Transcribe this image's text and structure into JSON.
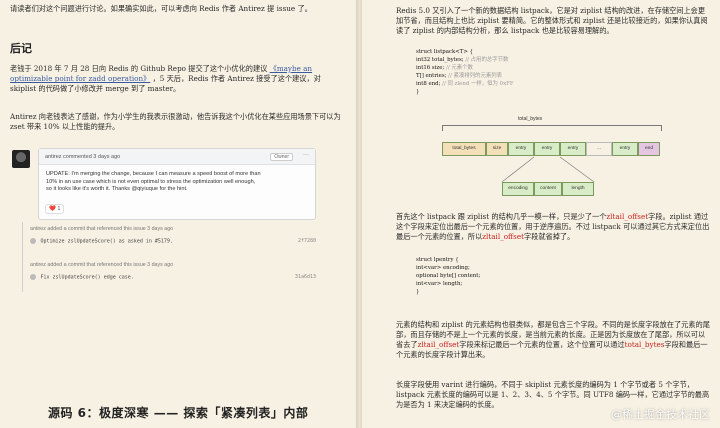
{
  "left": {
    "intro": "请读者们对这个问题进行讨论。如果确实如此，可以考虑向 Redis 作者 Antirez 提 issue 了。",
    "section_title": "后记",
    "para1_a": "老钱于 2018 年 7 月 28 日向 Redis 的 Github Repo 提交了这个小优化的建议",
    "para1_link": "《maybe an optimizable point for zadd operation》",
    "para1_b": "，5 天后，Redis 作者 Antirez 接受了这个建议，对 skiplist 的代码做了小修改并 merge 到了 master。",
    "para2": "Antirez 向老钱表达了感谢，作为小学生的我表示很激动，他告诉我这个小优化在某些应用场景下可以为 zset 带来 10% 以上性能的提升。",
    "comment": {
      "author_line": "antirez commented 3 days ago",
      "owner_badge": "Owner",
      "menu": "···",
      "body": "UPDATE: I'm merging the change, because I can measure a speed boost of more than 10% in an use case which is not even optimal to stress the optimization well enough, so it looks like it's worth it. Thanks @qiyiuque for the hint.",
      "reaction": "❤️ 1"
    },
    "refs": [
      {
        "line": "antirez added a commit that referenced this issue 3 days ago",
        "commit": "Optimize zslUpdateScore() as asked in #5179.",
        "sha": "2f7280"
      },
      {
        "line": "antirez added a commit that referenced this issue 3 days ago",
        "commit": "Fix zslUpdateScore() edge case.",
        "sha": "31a6d13"
      }
    ],
    "chapter_title": "源码 6：极度深寒 —— 探索「紧凑列表」内部"
  },
  "right": {
    "para1": "Redis 5.0 又引入了一个新的数据结构 listpack，它是对 ziplist 结构的改进，在存储空间上会更加节省，而且结构上也比 ziplist 要精简。它的整体形式和 ziplist 还是比较接近的，如果你认真阅读了 ziplist 的内部结构分析，那么 listpack 也是比较容易理解的。",
    "code1": [
      {
        "text": "struct listpack<T> {",
        "comment": ""
      },
      {
        "text": "    int32 total_bytes;",
        "comment": "// 占用的总字节数"
      },
      {
        "text": "    int16 size;",
        "comment": "// 元素个数"
      },
      {
        "text": "    T[] entries;",
        "comment": "// 紧凑排列的元素列表"
      },
      {
        "text": "    int8 end;",
        "comment": "// 同 zlend 一样，恒为 0xFF"
      },
      {
        "text": "}",
        "comment": ""
      }
    ],
    "diagram": {
      "top_label": "total_bytes",
      "cells": [
        "total_bytes",
        "size",
        "entry",
        "entry",
        "entry",
        "...",
        "entry",
        "end"
      ],
      "sub_cells": [
        "encoding",
        "content",
        "length"
      ]
    },
    "para2_a": "首先这个 listpack 跟 ziplist 的结构几乎一模一样，只是少了一个",
    "para2_red1": "zltail_offset",
    "para2_b": "字段。ziplist 通过这个字段来定位出最后一个元素的位置，用于逆序遍历。不过 listpack 可以通过其它方式来定位出最后一个元素的位置，所以",
    "para2_red2": "zltail_offset",
    "para2_c": "字段就省掉了。",
    "code2": [
      "struct lpentry {",
      "    int<var> encoding;",
      "    optional byte[] content;",
      "    int<var> length;",
      "}"
    ],
    "para3_a": "元素的结构和 ziplist 的元素结构也很类似，都是包含三个字段。不同的是长度字段放在了元素的尾部，而且存储的不是上一个元素的长度，是当前元素的长度。正是因为长度放在了尾部，所以可以省去了",
    "para3_red1": "zltail_offset",
    "para3_b": "字段来标记最后一个元素的位置，这个位置可以通过",
    "para3_red2": "total_bytes",
    "para3_c": "字段和最后一个元素的长度字段计算出来。",
    "para4": "长度字段使用 varint 进行编码，不同于 skiplist 元素长度的编码为 1 个字节或者 5 个字节，listpack 元素长度的编码可以是 1、2、3、4、5 个字节。同 UTF8 编码一样，它通过字节的最高为是否为 1 来决定编码的长度。"
  },
  "watermark": "@稀土掘金技术社区"
}
